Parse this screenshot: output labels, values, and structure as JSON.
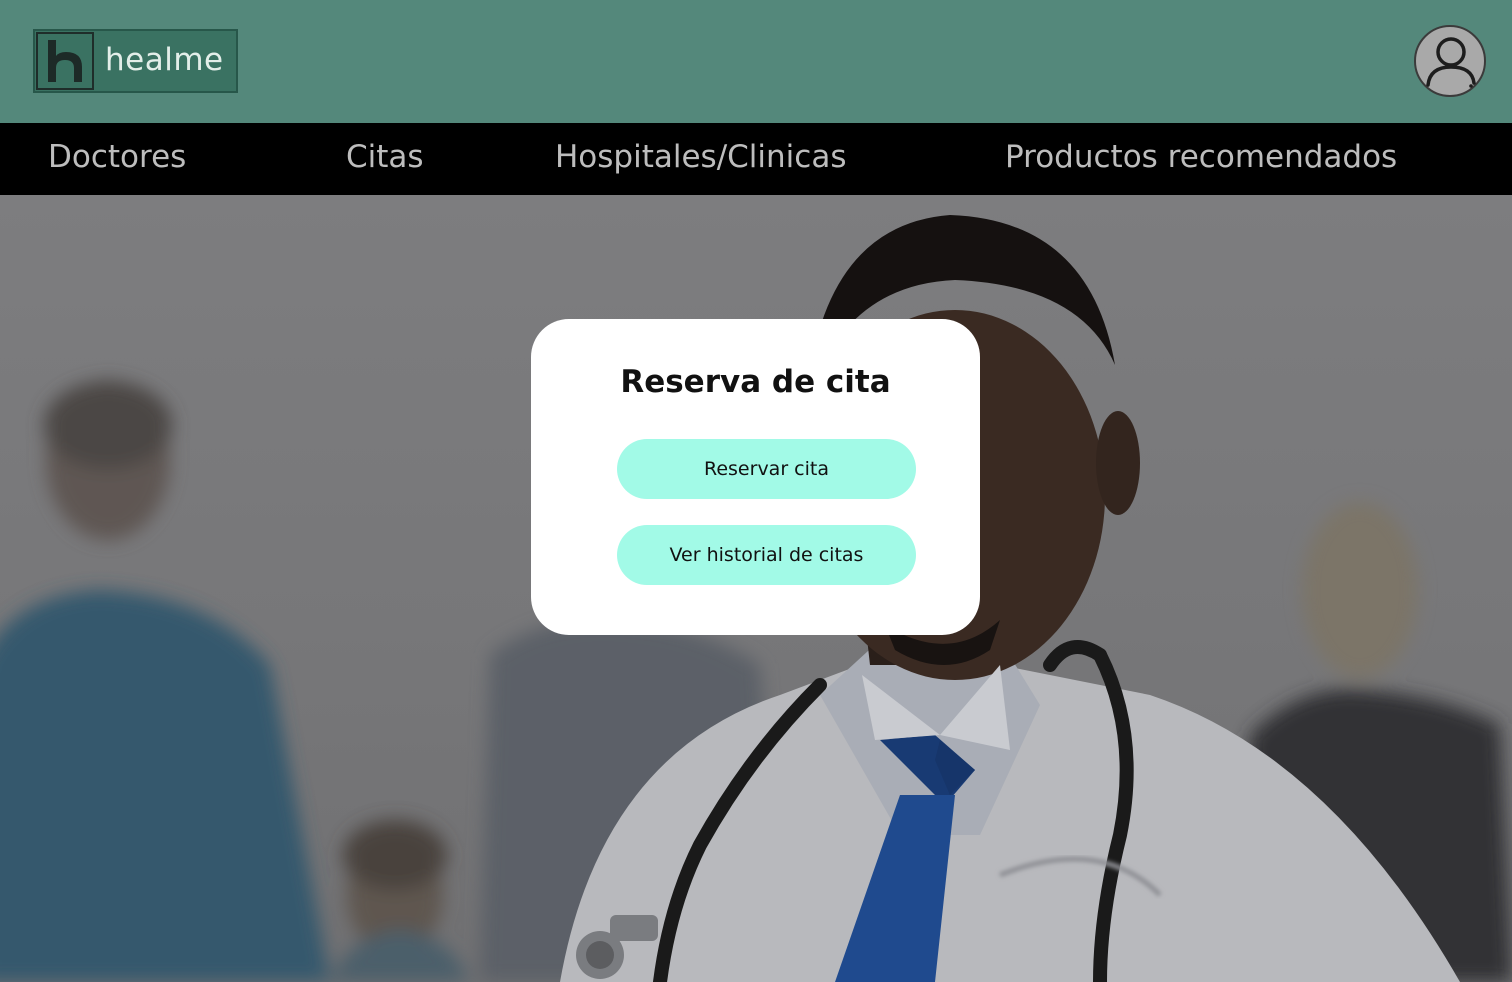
{
  "brand": {
    "name": "healme",
    "logo_icon": "healme-h-logo-icon"
  },
  "header": {
    "avatar_icon": "user-avatar-icon"
  },
  "nav": {
    "items": [
      {
        "label": "Doctores"
      },
      {
        "label": "Citas"
      },
      {
        "label": "Hospitales/Clinicas"
      },
      {
        "label": "Productos recomendados"
      }
    ]
  },
  "modal": {
    "title": "Reserva de cita",
    "primary_button": "Reservar cita",
    "secondary_button": "Ver historial de citas"
  },
  "colors": {
    "header_bg": "#54887b",
    "nav_bg": "#000000",
    "button_bg": "#a2fae7",
    "logo_bg": "#3a7262"
  }
}
